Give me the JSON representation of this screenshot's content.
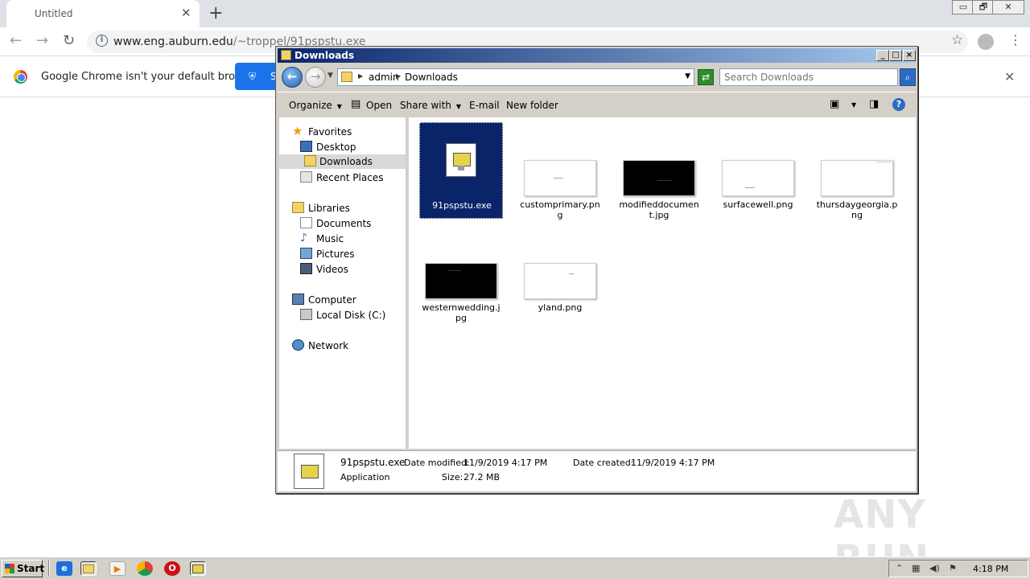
{
  "browser": {
    "tab_title": "Untitled",
    "tab_close": "✕",
    "new_tab": "+",
    "url_host": "www.eng.auburn.edu",
    "url_path": "/~troppel/91pspstu.exe",
    "window_controls": [
      "▭",
      "🗗",
      "✕"
    ]
  },
  "infobar": {
    "message": "Google Chrome isn't your default browser",
    "button_label": "S",
    "close": "✕"
  },
  "explorer": {
    "title": "Downloads",
    "breadcrumb": [
      "admin",
      "Downloads"
    ],
    "search_placeholder": "Search Downloads",
    "commands": {
      "organize": "Organize",
      "open": "Open",
      "share_with": "Share with",
      "email": "E-mail",
      "new_folder": "New folder"
    },
    "nav": {
      "favorites": "Favorites",
      "desktop": "Desktop",
      "downloads": "Downloads",
      "recent_places": "Recent Places",
      "libraries": "Libraries",
      "documents": "Documents",
      "music": "Music",
      "pictures": "Pictures",
      "videos": "Videos",
      "computer": "Computer",
      "local_disk": "Local Disk (C:)",
      "network": "Network"
    },
    "files": [
      {
        "name": "91pspstu.exe",
        "kind": "exe",
        "selected": true
      },
      {
        "name": "customprimary.png",
        "kind": "light"
      },
      {
        "name": "modifieddocument.jpg",
        "kind": "dark"
      },
      {
        "name": "surfacewell.png",
        "kind": "light"
      },
      {
        "name": "thursdaygeorgia.png",
        "kind": "light"
      },
      {
        "name": "westernwedding.jpg",
        "kind": "dark"
      },
      {
        "name": "yland.png",
        "kind": "light"
      }
    ],
    "details": {
      "name": "91pspstu.exe",
      "type": "Application",
      "modified_label": "Date modified:",
      "modified_value": "11/9/2019 4:17 PM",
      "created_label": "Date created:",
      "created_value": "11/9/2019 4:17 PM",
      "size_label": "Size:",
      "size_value": "27.2 MB"
    }
  },
  "watermark": "ANY RUN",
  "taskbar": {
    "start": "Start",
    "clock": "4:18 PM"
  },
  "colors": {
    "title_bar": "#0a246a",
    "selection": "#0a246a",
    "chrome_blue": "#1a73e8"
  }
}
